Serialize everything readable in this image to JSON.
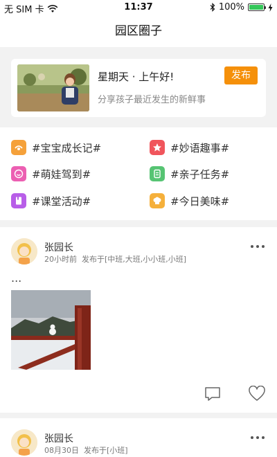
{
  "status_bar": {
    "carrier": "无 SIM 卡",
    "time": "11:37",
    "battery": "100%",
    "battery_level": 1.0
  },
  "nav": {
    "title": "园区圈子"
  },
  "composer": {
    "greeting": "星期天 · 上午好!",
    "hint": "分享孩子最近发生的新鲜事",
    "publish_label": "发布"
  },
  "topics": [
    {
      "label": "#宝宝成长记#",
      "color": "#f5a13a"
    },
    {
      "label": "#妙语趣事#",
      "color": "#f0555c"
    },
    {
      "label": "#萌娃驾到#",
      "color": "#ec5fb2"
    },
    {
      "label": "#亲子任务#",
      "color": "#56c473"
    },
    {
      "label": "#课堂活动#",
      "color": "#b85ee8"
    },
    {
      "label": "#今日美味#",
      "color": "#f5b03b"
    }
  ],
  "posts": [
    {
      "author": "张园长",
      "time": "20小时前",
      "scope": "发布于[中班,大班,小小班,小班]",
      "text": "..."
    },
    {
      "author": "张园长",
      "time": "08月30日",
      "scope": "发布于[小班]"
    }
  ],
  "icons": {
    "wifi": "wifi-icon",
    "bluetooth": "bluetooth-icon",
    "charging": "charging-icon",
    "comment": "comment-icon",
    "like": "heart-icon",
    "more": "more-icon"
  }
}
